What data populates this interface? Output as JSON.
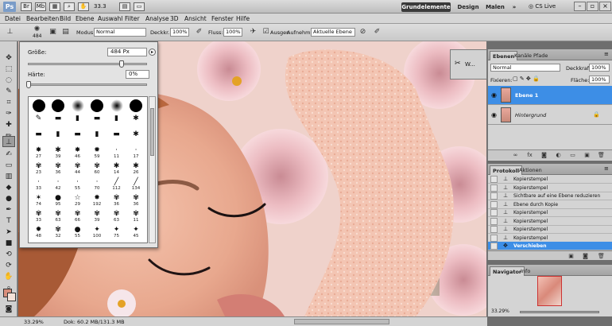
{
  "app": {
    "logo": "Ps",
    "zoom_combo": "33.3",
    "workspaces": {
      "grundelemente": "Grundelemente",
      "design": "Design",
      "malen": "Malen",
      "more": "»"
    },
    "cs_live": "CS Live"
  },
  "menu": [
    "Datei",
    "Bearbeiten",
    "Bild",
    "Ebene",
    "Auswahl",
    "Filter",
    "Analyse",
    "3D",
    "Ansicht",
    "Fenster",
    "Hilfe"
  ],
  "options": {
    "brush_size": "484",
    "modus_label": "Modus:",
    "modus_value": "Normal",
    "deckkraft_label": "Deckkr.:",
    "deckkraft_value": "100%",
    "fluss_label": "Fluss:",
    "fluss_value": "100%",
    "ausger_label": "Ausger.",
    "aufnehm_label": "Aufnehm.:",
    "aufnehm_value": "Aktuelle Ebene"
  },
  "brush_picker": {
    "size_label": "Größe:",
    "size_value": "484 Px",
    "size_fraction": 0.78,
    "hardness_label": "Härte:",
    "hardness_value": "0%",
    "hardness_fraction": 0.0,
    "presets": [
      {
        "kind": "dot",
        "num": ""
      },
      {
        "kind": "dot",
        "num": ""
      },
      {
        "kind": "soft",
        "num": ""
      },
      {
        "kind": "dot",
        "num": ""
      },
      {
        "kind": "soft",
        "num": ""
      },
      {
        "kind": "dot",
        "num": ""
      },
      {
        "kind": "glyph",
        "glyph": "✎",
        "num": ""
      },
      {
        "kind": "glyph",
        "glyph": "▬",
        "num": ""
      },
      {
        "kind": "glyph",
        "glyph": "▮",
        "num": ""
      },
      {
        "kind": "glyph",
        "glyph": "▬",
        "num": ""
      },
      {
        "kind": "glyph",
        "glyph": "▮",
        "num": ""
      },
      {
        "kind": "glyph",
        "glyph": "✱",
        "num": ""
      },
      {
        "kind": "glyph",
        "glyph": "▬",
        "num": ""
      },
      {
        "kind": "glyph",
        "glyph": "▮",
        "num": ""
      },
      {
        "kind": "glyph",
        "glyph": "▬",
        "num": ""
      },
      {
        "kind": "glyph",
        "glyph": "▮",
        "num": ""
      },
      {
        "kind": "glyph",
        "glyph": "▬",
        "num": ""
      },
      {
        "kind": "glyph",
        "glyph": "✱",
        "num": ""
      },
      {
        "kind": "glyph",
        "glyph": "✸",
        "num": "27"
      },
      {
        "kind": "glyph",
        "glyph": "✱",
        "num": "39"
      },
      {
        "kind": "glyph",
        "glyph": "✸",
        "num": "46"
      },
      {
        "kind": "glyph",
        "glyph": "✹",
        "num": "59"
      },
      {
        "kind": "glyph",
        "glyph": "·",
        "num": "11"
      },
      {
        "kind": "glyph",
        "glyph": "·",
        "num": "17"
      },
      {
        "kind": "glyph",
        "glyph": "✾",
        "num": "23"
      },
      {
        "kind": "glyph",
        "glyph": "✾",
        "num": "36"
      },
      {
        "kind": "glyph",
        "glyph": "✾",
        "num": "44"
      },
      {
        "kind": "glyph",
        "glyph": "✾",
        "num": "60"
      },
      {
        "kind": "glyph",
        "glyph": "✱",
        "num": "14"
      },
      {
        "kind": "glyph",
        "glyph": "✱",
        "num": "26"
      },
      {
        "kind": "glyph",
        "glyph": "·",
        "num": "33"
      },
      {
        "kind": "glyph",
        "glyph": "·",
        "num": "42"
      },
      {
        "kind": "glyph",
        "glyph": "·",
        "num": "55"
      },
      {
        "kind": "glyph",
        "glyph": "·",
        "num": "70"
      },
      {
        "kind": "glyph",
        "glyph": "╱",
        "num": "112"
      },
      {
        "kind": "glyph",
        "glyph": "╱",
        "num": "134"
      },
      {
        "kind": "glyph",
        "glyph": "✶",
        "num": "74"
      },
      {
        "kind": "glyph",
        "glyph": "●",
        "num": "95"
      },
      {
        "kind": "glyph",
        "glyph": "☆",
        "num": "29"
      },
      {
        "kind": "glyph",
        "glyph": "✸",
        "num": "192"
      },
      {
        "kind": "glyph",
        "glyph": "✾",
        "num": "36"
      },
      {
        "kind": "glyph",
        "glyph": "✾",
        "num": "36"
      },
      {
        "kind": "glyph",
        "glyph": "✾",
        "num": "33"
      },
      {
        "kind": "glyph",
        "glyph": "✾",
        "num": "63"
      },
      {
        "kind": "glyph",
        "glyph": "✾",
        "num": "66"
      },
      {
        "kind": "glyph",
        "glyph": "✾",
        "num": "39"
      },
      {
        "kind": "glyph",
        "glyph": "✾",
        "num": "63"
      },
      {
        "kind": "glyph",
        "glyph": "✾",
        "num": "11"
      },
      {
        "kind": "glyph",
        "glyph": "✹",
        "num": "48"
      },
      {
        "kind": "glyph",
        "glyph": "✾",
        "num": "32"
      },
      {
        "kind": "glyph",
        "glyph": "●",
        "num": "55"
      },
      {
        "kind": "glyph",
        "glyph": "✦",
        "num": "100"
      },
      {
        "kind": "glyph",
        "glyph": "✦",
        "num": "75"
      },
      {
        "kind": "glyph",
        "glyph": "✦",
        "num": "45"
      }
    ]
  },
  "mini_panel": {
    "label": "W..."
  },
  "layers": {
    "tabs": [
      "Ebenen",
      "Kanäle",
      "Pfade"
    ],
    "blend_mode": "Normal",
    "deckkraft_label": "Deckkraft:",
    "deckkraft_value": "100%",
    "fixieren_label": "Fixieren:",
    "flaeche_label": "Fläche:",
    "flaeche_value": "100%",
    "items": [
      {
        "name": "Ebene 1",
        "selected": true
      },
      {
        "name": "Hintergrund",
        "selected": false
      }
    ]
  },
  "history": {
    "tabs": [
      "Protokoll",
      "Aktionen"
    ],
    "items": [
      {
        "label": "Kopierstempel",
        "selected": false
      },
      {
        "label": "Kopierstempel",
        "selected": false
      },
      {
        "label": "Sichtbare auf eine Ebene reduzieren",
        "selected": false
      },
      {
        "label": "Ebene durch Kopie",
        "selected": false
      },
      {
        "label": "Kopierstempel",
        "selected": false
      },
      {
        "label": "Kopierstempel",
        "selected": false
      },
      {
        "label": "Kopierstempel",
        "selected": false
      },
      {
        "label": "Kopierstempel",
        "selected": false
      },
      {
        "label": "Verschieben",
        "selected": true
      }
    ]
  },
  "navigator": {
    "tabs": [
      "Navigator",
      "Info"
    ],
    "zoom": "33.29%"
  },
  "status": {
    "zoom": "33.29%",
    "doc": "Dok: 60.2 MB/131.3 MB"
  }
}
